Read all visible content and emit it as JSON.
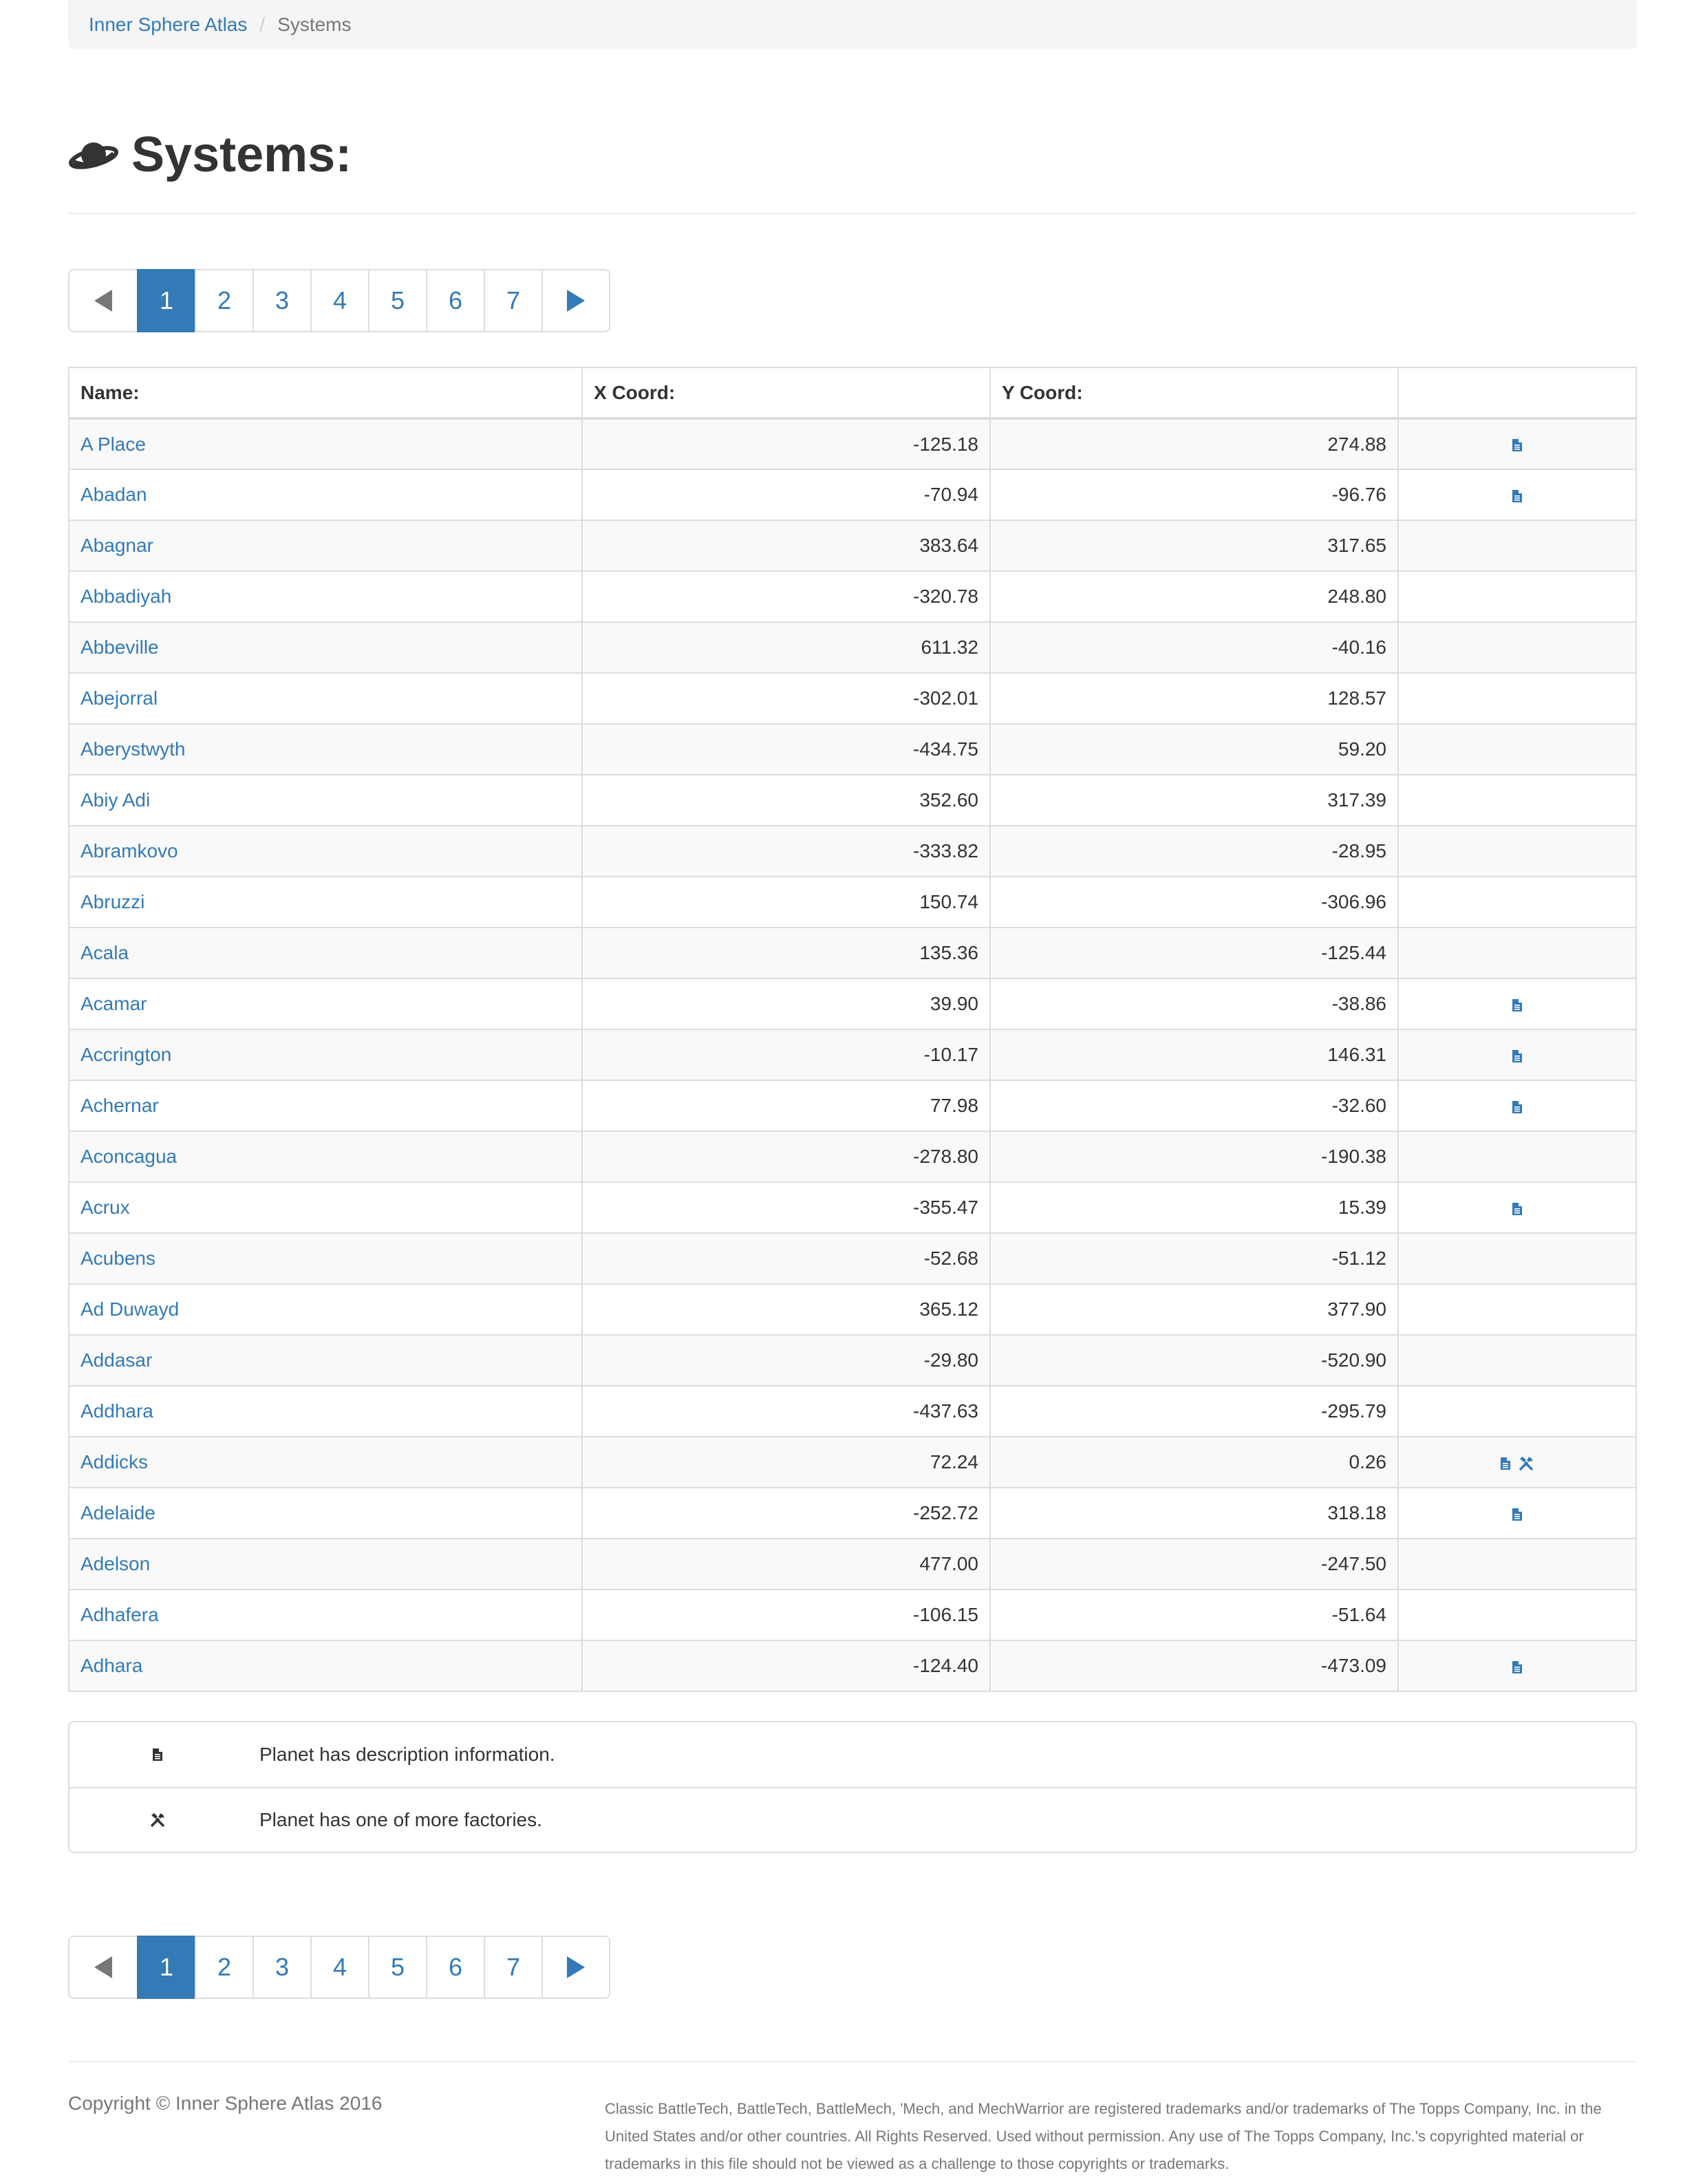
{
  "breadcrumb": {
    "home": "Inner Sphere Atlas",
    "separator": "/",
    "current": "Systems"
  },
  "page": {
    "title": "Systems:",
    "icon": "planet-icon"
  },
  "pagination": {
    "pages": [
      "1",
      "2",
      "3",
      "4",
      "5",
      "6",
      "7"
    ],
    "active": "1",
    "prev_icon": "triangle-left-icon",
    "next_icon": "triangle-right-icon"
  },
  "table": {
    "headers": {
      "name": "Name:",
      "x": "X Coord:",
      "y": "Y Coord:",
      "info": ""
    },
    "rows": [
      {
        "name": "A Place",
        "x": "-125.18",
        "y": "274.88",
        "desc": true,
        "factory": false
      },
      {
        "name": "Abadan",
        "x": "-70.94",
        "y": "-96.76",
        "desc": true,
        "factory": false
      },
      {
        "name": "Abagnar",
        "x": "383.64",
        "y": "317.65",
        "desc": false,
        "factory": false
      },
      {
        "name": "Abbadiyah",
        "x": "-320.78",
        "y": "248.80",
        "desc": false,
        "factory": false
      },
      {
        "name": "Abbeville",
        "x": "611.32",
        "y": "-40.16",
        "desc": false,
        "factory": false
      },
      {
        "name": "Abejorral",
        "x": "-302.01",
        "y": "128.57",
        "desc": false,
        "factory": false
      },
      {
        "name": "Aberystwyth",
        "x": "-434.75",
        "y": "59.20",
        "desc": false,
        "factory": false
      },
      {
        "name": "Abiy Adi",
        "x": "352.60",
        "y": "317.39",
        "desc": false,
        "factory": false
      },
      {
        "name": "Abramkovo",
        "x": "-333.82",
        "y": "-28.95",
        "desc": false,
        "factory": false
      },
      {
        "name": "Abruzzi",
        "x": "150.74",
        "y": "-306.96",
        "desc": false,
        "factory": false
      },
      {
        "name": "Acala",
        "x": "135.36",
        "y": "-125.44",
        "desc": false,
        "factory": false
      },
      {
        "name": "Acamar",
        "x": "39.90",
        "y": "-38.86",
        "desc": true,
        "factory": false
      },
      {
        "name": "Accrington",
        "x": "-10.17",
        "y": "146.31",
        "desc": true,
        "factory": false
      },
      {
        "name": "Achernar",
        "x": "77.98",
        "y": "-32.60",
        "desc": true,
        "factory": false
      },
      {
        "name": "Aconcagua",
        "x": "-278.80",
        "y": "-190.38",
        "desc": false,
        "factory": false
      },
      {
        "name": "Acrux",
        "x": "-355.47",
        "y": "15.39",
        "desc": true,
        "factory": false
      },
      {
        "name": "Acubens",
        "x": "-52.68",
        "y": "-51.12",
        "desc": false,
        "factory": false
      },
      {
        "name": "Ad Duwayd",
        "x": "365.12",
        "y": "377.90",
        "desc": false,
        "factory": false
      },
      {
        "name": "Addasar",
        "x": "-29.80",
        "y": "-520.90",
        "desc": false,
        "factory": false
      },
      {
        "name": "Addhara",
        "x": "-437.63",
        "y": "-295.79",
        "desc": false,
        "factory": false
      },
      {
        "name": "Addicks",
        "x": "72.24",
        "y": "0.26",
        "desc": true,
        "factory": true
      },
      {
        "name": "Adelaide",
        "x": "-252.72",
        "y": "318.18",
        "desc": true,
        "factory": false
      },
      {
        "name": "Adelson",
        "x": "477.00",
        "y": "-247.50",
        "desc": false,
        "factory": false
      },
      {
        "name": "Adhafera",
        "x": "-106.15",
        "y": "-51.64",
        "desc": false,
        "factory": false
      },
      {
        "name": "Adhara",
        "x": "-124.40",
        "y": "-473.09",
        "desc": true,
        "factory": false
      }
    ]
  },
  "legend": {
    "description": {
      "icon": "document-icon",
      "text": "Planet has description information."
    },
    "factory": {
      "icon": "tools-icon",
      "text": "Planet has one of more factories."
    }
  },
  "footer": {
    "copyright": "Copyright © Inner Sphere Atlas 2016",
    "legal": "Classic BattleTech, BattleTech, BattleMech, 'Mech, and MechWarrior are registered trademarks and/or trademarks of The Topps Company, Inc. in the United States and/or other countries. All Rights Reserved. Used without permission. Any use of The Topps Company, Inc.'s copyrighted material or trademarks in this file should not be viewed as a challenge to those copyrights or trademarks."
  },
  "colors": {
    "link": "#337ab7",
    "active_page": "#337ab7",
    "stripe": "#f9f9f9",
    "border": "#dddddd"
  }
}
